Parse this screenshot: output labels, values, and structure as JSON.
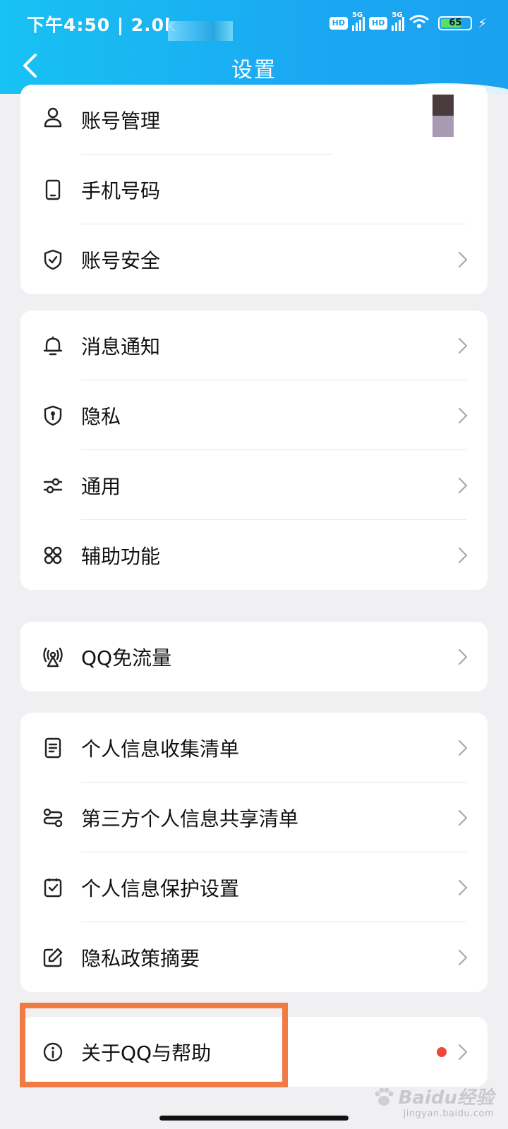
{
  "status_bar": {
    "time": "下午4:50 | 2.0k",
    "hd1": "HD",
    "net1": "5G",
    "hd2": "HD",
    "net2": "5G",
    "battery": "65"
  },
  "header": {
    "title": "设置"
  },
  "groups": [
    {
      "items": [
        {
          "label": "账号管理",
          "icon": "user-icon"
        },
        {
          "label": "手机号码",
          "icon": "phone-icon"
        },
        {
          "label": "账号安全",
          "icon": "shield-check-icon"
        }
      ]
    },
    {
      "items": [
        {
          "label": "消息通知",
          "icon": "bell-icon"
        },
        {
          "label": "隐私",
          "icon": "privacy-shield-icon"
        },
        {
          "label": "通用",
          "icon": "sliders-icon"
        },
        {
          "label": "辅助功能",
          "icon": "command-icon"
        }
      ]
    },
    {
      "items": [
        {
          "label": "QQ免流量",
          "icon": "antenna-icon"
        }
      ]
    },
    {
      "items": [
        {
          "label": "个人信息收集清单",
          "icon": "document-icon"
        },
        {
          "label": "第三方个人信息共享清单",
          "icon": "share-route-icon"
        },
        {
          "label": "个人信息保护设置",
          "icon": "checkbox-icon"
        },
        {
          "label": "隐私政策摘要",
          "icon": "edit-icon"
        }
      ]
    },
    {
      "items": [
        {
          "label": "关于QQ与帮助",
          "icon": "info-icon",
          "badge": "red-dot"
        }
      ]
    }
  ],
  "colors": {
    "header_start": "#18c2f3",
    "header_end": "#1aa1f0",
    "highlight": "#f07b45",
    "badge": "#f0473b"
  },
  "watermark": {
    "brand": "Baidu经验",
    "site": "jingyan.baidu.com"
  }
}
